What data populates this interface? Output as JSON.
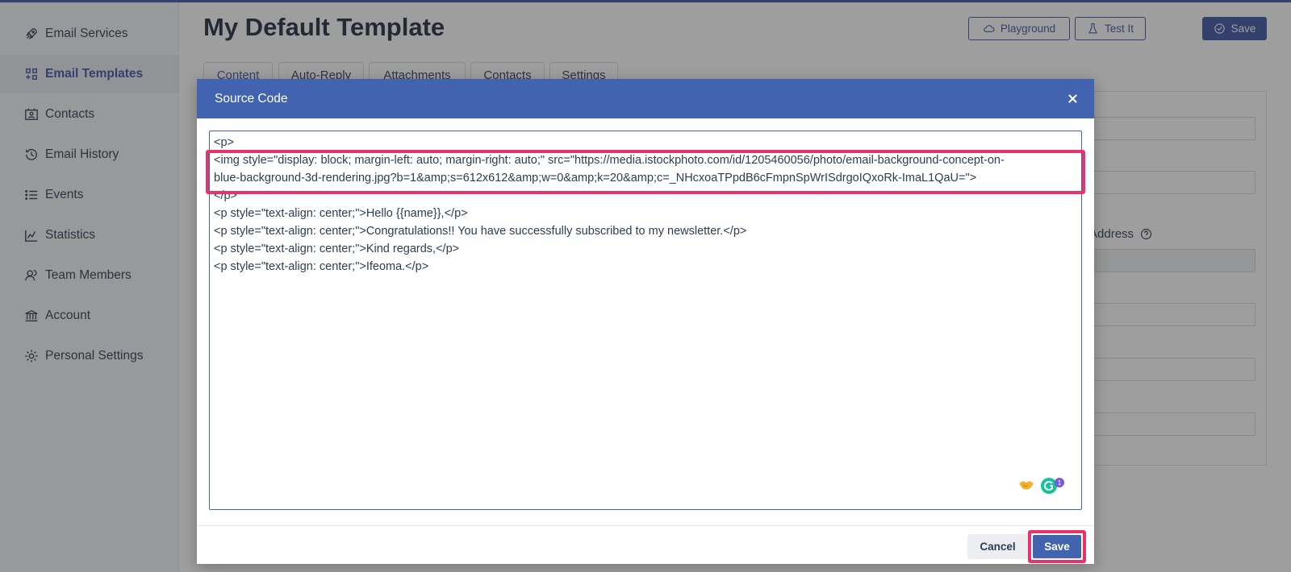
{
  "sidebar": {
    "items": [
      {
        "label": "Email Services",
        "icon": "rocket-icon",
        "active": false
      },
      {
        "label": "Email Templates",
        "icon": "template-icon",
        "active": true
      },
      {
        "label": "Contacts",
        "icon": "contact-card-icon",
        "active": false
      },
      {
        "label": "Email History",
        "icon": "history-icon",
        "active": false
      },
      {
        "label": "Events",
        "icon": "list-icon",
        "active": false
      },
      {
        "label": "Statistics",
        "icon": "chart-icon",
        "active": false
      },
      {
        "label": "Team Members",
        "icon": "team-icon",
        "active": false
      },
      {
        "label": "Account",
        "icon": "bank-icon",
        "active": false
      },
      {
        "label": "Personal Settings",
        "icon": "gear-icon",
        "active": false
      }
    ]
  },
  "header": {
    "title": "My Default Template",
    "playground_label": "Playground",
    "test_label": "Test It",
    "save_label": "Save"
  },
  "tabs": [
    "Content",
    "Auto-Reply",
    "Attachments",
    "Contacts",
    "Settings"
  ],
  "background_form": {
    "visible_label_fragment": "il Address"
  },
  "modal": {
    "title": "Source Code",
    "code_lines": [
      "<p>",
      "<img style=\"display: block; margin-left: auto; margin-right: auto;\" src=\"https://media.istockphoto.com/id/1205460056/photo/email-background-concept-on-",
      "blue-background-3d-rendering.jpg?b=1&amp;s=612x612&amp;w=0&amp;k=20&amp;c=_NHcxoaTPpdB6cFmpnSpWrISdrgoIQxoRk-ImaL1QaU=\">",
      "</p>",
      "<p style=\"text-align: center;\">Hello {{name}},</p>",
      "<p style=\"text-align: center;\">Congratulations!! You have successfully subscribed to my newsletter.</p>",
      "<p style=\"text-align: center;\">Kind regards,</p>",
      "<p style=\"text-align: center;\">Ifeoma.</p>"
    ],
    "grammarly_count": "1",
    "cancel_label": "Cancel",
    "save_label": "Save"
  },
  "colors": {
    "accent": "#3f55a5",
    "modal_header": "#4263b0",
    "highlight": "#e8336a"
  }
}
